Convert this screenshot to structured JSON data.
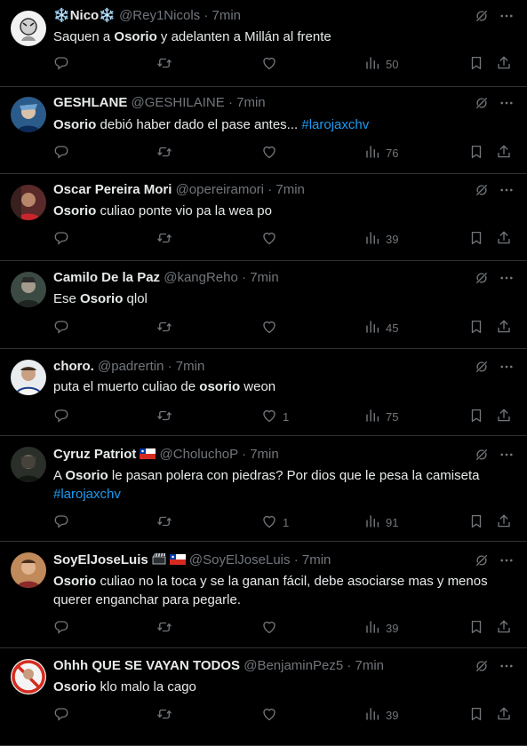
{
  "colors": {
    "background": "#000000",
    "text": "#e7e9ea",
    "muted": "#71767b",
    "link": "#1d9bf0",
    "divider": "#2f3336"
  },
  "icons": [
    "reply-icon",
    "retweet-icon",
    "like-icon",
    "views-icon",
    "bookmark-icon",
    "share-icon",
    "grok-icon",
    "more-icon"
  ],
  "tweets": [
    {
      "name_prefix": "❄️",
      "name": "Nico",
      "name_suffix": "❄️",
      "handle": "@Rey1Nicols",
      "dot": "·",
      "time": "7min",
      "text": [
        {
          "t": "Saquen a "
        },
        {
          "b": "Osorio"
        },
        {
          "t": " y adelanten a Millán al frente"
        }
      ],
      "views": "50",
      "likes": ""
    },
    {
      "name": "GESHLANE",
      "handle": "@GESHILAINE",
      "dot": "·",
      "time": "7min",
      "text": [
        {
          "b": "Osorio"
        },
        {
          "t": " debió haber dado el pase antes... "
        },
        {
          "h": "#larojaxchv"
        }
      ],
      "views": "76",
      "likes": ""
    },
    {
      "name": "Oscar Pereira Mori",
      "handle": "@opereiramori",
      "dot": "·",
      "time": "7min",
      "text": [
        {
          "b": "Osorio"
        },
        {
          "t": " culiao ponte vio pa la wea po"
        }
      ],
      "views": "39",
      "likes": ""
    },
    {
      "name": "Camilo De la Paz",
      "handle": "@kangReho",
      "dot": "·",
      "time": "7min",
      "text": [
        {
          "t": "Ese "
        },
        {
          "b": "Osorio"
        },
        {
          "t": " qlol"
        }
      ],
      "views": "45",
      "likes": ""
    },
    {
      "name": "choro.",
      "handle": "@padrertin",
      "dot": "·",
      "time": "7min",
      "text": [
        {
          "t": "puta el muerto culiao de "
        },
        {
          "b": "osorio"
        },
        {
          "t": " weon"
        }
      ],
      "views": "75",
      "likes": "1"
    },
    {
      "name": "Cyruz Patriot",
      "flag": true,
      "handle": "@CholuchoP",
      "dot": "·",
      "time": "7min",
      "text": [
        {
          "t": "A "
        },
        {
          "b": "Osorio"
        },
        {
          "t": " le pasan polera con piedras? Por dios que le pesa la camiseta"
        },
        {
          "br": true
        },
        {
          "h": "#larojaxchv"
        }
      ],
      "views": "91",
      "likes": "1"
    },
    {
      "name": "SoyElJoseLuis",
      "clap": true,
      "flag": true,
      "handle": "@SoyElJoseLuis",
      "dot": "·",
      "time": "7min",
      "text": [
        {
          "b": "Osorio"
        },
        {
          "t": " culiao no la toca y se la ganan fácil, debe asociarse mas y menos"
        },
        {
          "br": true
        },
        {
          "t": "querer enganchar para pegarle."
        }
      ],
      "views": "39",
      "likes": ""
    },
    {
      "name": "Ohhh QUE SE VAYAN TODOS",
      "handle": "@BenjaminPez5",
      "dot": "·",
      "time": "7min",
      "text": [
        {
          "b": "Osorio"
        },
        {
          "t": " klo malo la cago"
        }
      ],
      "views": "39",
      "likes": ""
    }
  ]
}
